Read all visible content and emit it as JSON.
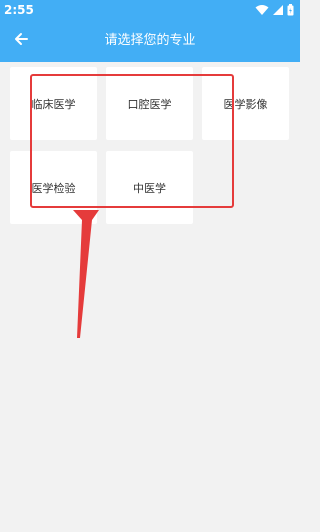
{
  "status_bar": {
    "time": "2:55"
  },
  "header": {
    "title": "请选择您的专业"
  },
  "majors": [
    {
      "label": "临床医学"
    },
    {
      "label": "口腔医学"
    },
    {
      "label": "医学影像"
    },
    {
      "label": "医学检验"
    },
    {
      "label": "中医学"
    }
  ],
  "colors": {
    "primary": "#42aef5",
    "annotation": "#e53b3b",
    "background": "#f2f2f2"
  },
  "icons": {
    "back": "arrow-left-icon",
    "wifi": "wifi-icon",
    "signal": "signal-icon",
    "battery": "battery-icon"
  }
}
